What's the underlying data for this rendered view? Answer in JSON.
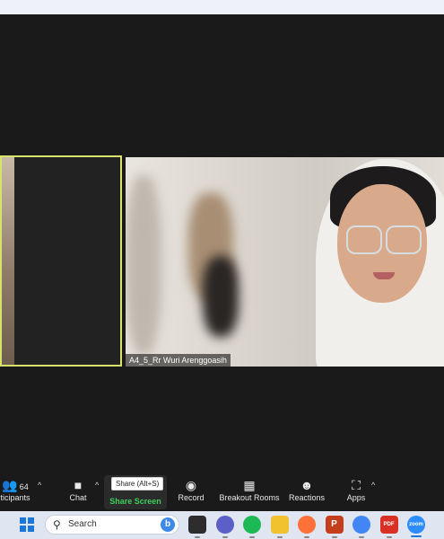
{
  "meeting": {
    "left_participant": "",
    "right_participant_name": "A4_5_Rr Wuri Arenggoasih"
  },
  "toolbar": {
    "participants_label": "ticipants",
    "participants_count": "64",
    "chat_label": "Chat",
    "share_label": "Share Screen",
    "share_tooltip": "Share (Alt+S)",
    "record_label": "Record",
    "breakout_label": "Breakout Rooms",
    "reactions_label": "Reactions",
    "apps_label": "Apps",
    "caret": "^"
  },
  "taskbar": {
    "search_placeholder": "Search",
    "search_icon": "magnifier-icon",
    "apps": [
      {
        "name": "task-view",
        "color": "#2d2d2d",
        "text": ""
      },
      {
        "name": "teams",
        "color": "#5b5fc7",
        "text": ""
      },
      {
        "name": "spotify",
        "color": "#1db954",
        "text": ""
      },
      {
        "name": "file-explorer",
        "color": "#f2c12e",
        "text": ""
      },
      {
        "name": "firefox",
        "color": "#ff7139",
        "text": ""
      },
      {
        "name": "powerpoint",
        "color": "#c43e1c",
        "text": "P"
      },
      {
        "name": "chrome",
        "color": "#4285f4",
        "text": ""
      },
      {
        "name": "pdf-reader",
        "color": "#d93025",
        "text": "PDF"
      },
      {
        "name": "zoom",
        "color": "#2d8cff",
        "text": "zoom"
      }
    ]
  },
  "colors": {
    "active_speaker_border": "#d8e26a",
    "share_green": "#3ccf5a",
    "toolbar_bg": "#1a1a1a",
    "taskbar_bg": "#dfe6f1"
  }
}
